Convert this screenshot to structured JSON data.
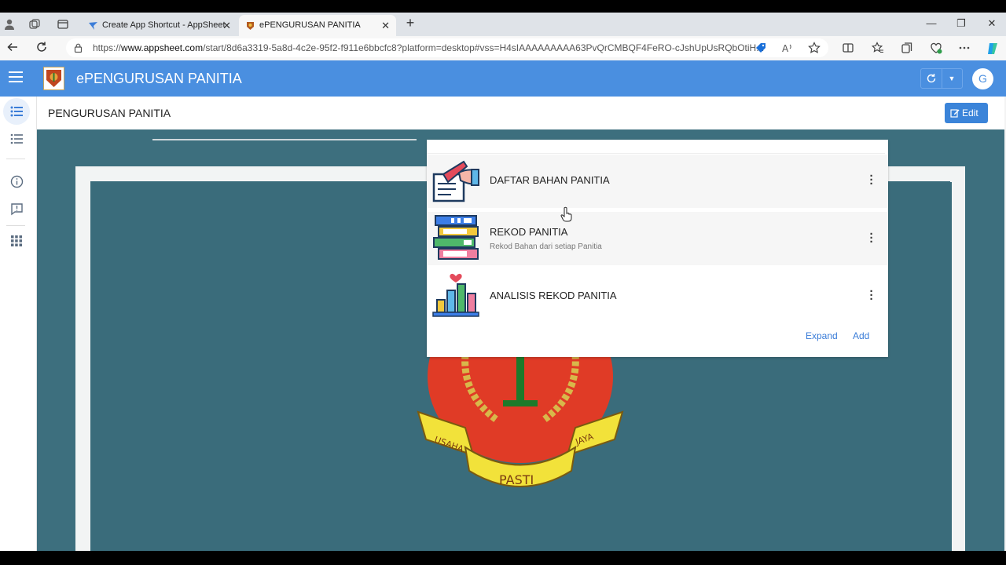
{
  "browser": {
    "tabs": [
      {
        "title": "Create App Shortcut - AppSheet",
        "close": "✕"
      },
      {
        "title": "ePENGURUSAN PANITIA",
        "close": "✕"
      }
    ],
    "new_tab": "+",
    "window_controls": {
      "minimize": "—",
      "restore": "❐",
      "close": "✕"
    },
    "url_prefix": "https://",
    "url_host": "www.appsheet.com",
    "url_rest": "/start/8d6a3319-5a8d-4c2e-95f2-f911e6bbcfc8?platform=desktop#vss=H4sIAAAAAAAAA63PvQrCMBQF4FeRO-cJshUpUsRQbOtiH..."
  },
  "app": {
    "title": "ePENGURUSAN PANITIA",
    "avatar_letter": "G",
    "accent_color": "#4a8fe0"
  },
  "page": {
    "title": "PENGURUSAN PANITIA",
    "edit_label": "Edit"
  },
  "sidebar": {
    "items": [
      "list-view-icon",
      "list-icon",
      "info-icon",
      "feedback-icon",
      "apps-grid-icon"
    ]
  },
  "card": {
    "rows": [
      {
        "title": "DAFTAR BAHAN PANITIA",
        "subtitle": ""
      },
      {
        "title": "REKOD PANITIA",
        "subtitle": "Rekod Bahan dari setiap Panitia"
      },
      {
        "title": "ANALISIS REKOD PANITIA",
        "subtitle": ""
      }
    ],
    "expand_label": "Expand",
    "add_label": "Add"
  },
  "background": {
    "crest_texts": [
      "USAHA",
      "PASTI",
      "JAYA"
    ]
  }
}
